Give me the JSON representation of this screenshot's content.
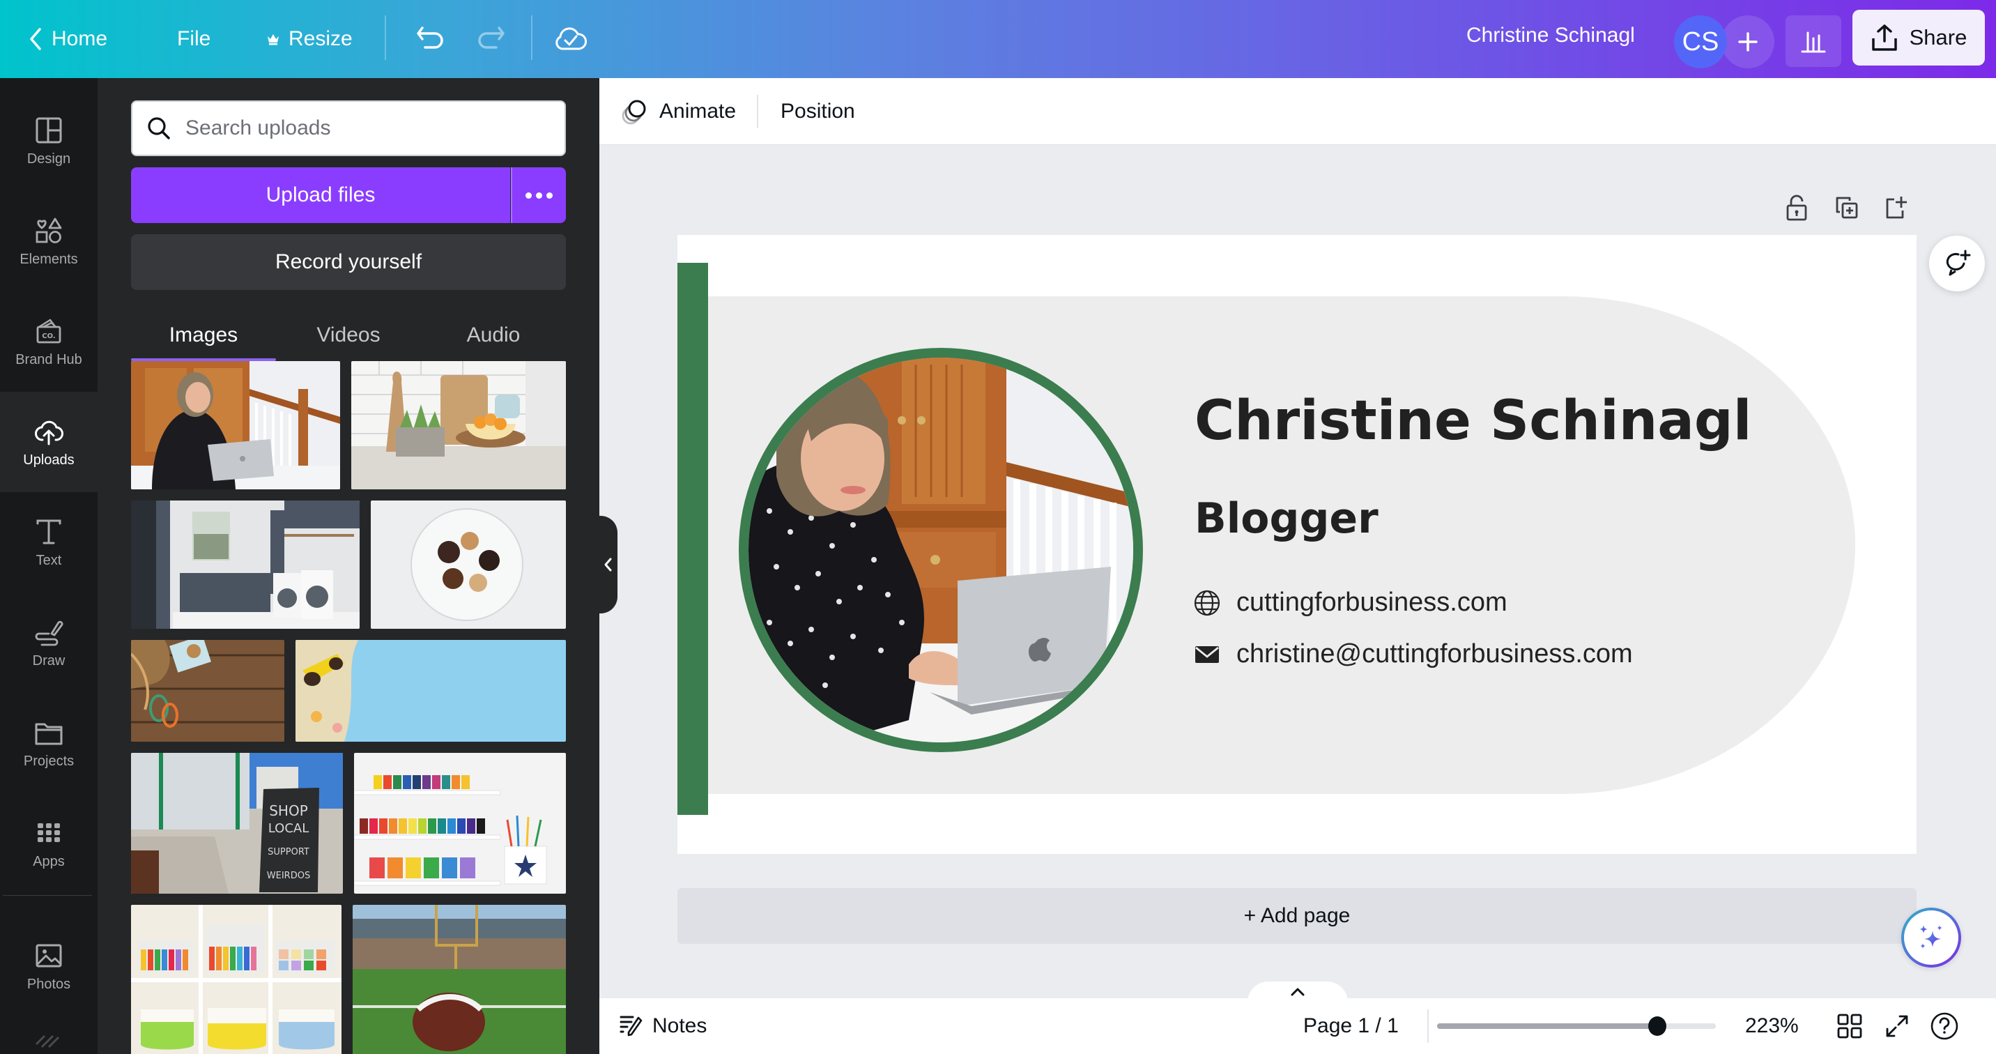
{
  "topbar": {
    "home_label": "Home",
    "file_label": "File",
    "resize_label": "Resize",
    "user_name": "Christine Schinagl",
    "avatar_initials": "CS",
    "share_label": "Share",
    "gradient_colors": [
      "#00c4cc",
      "#7d2ae8"
    ]
  },
  "rail": {
    "items": [
      {
        "label": "Design",
        "icon": "design-icon"
      },
      {
        "label": "Elements",
        "icon": "elements-icon"
      },
      {
        "label": "Brand Hub",
        "icon": "brand-hub-icon"
      },
      {
        "label": "Uploads",
        "icon": "upload-cloud-icon",
        "active": true
      },
      {
        "label": "Text",
        "icon": "text-icon"
      },
      {
        "label": "Draw",
        "icon": "draw-icon"
      },
      {
        "label": "Projects",
        "icon": "folder-icon"
      },
      {
        "label": "Apps",
        "icon": "apps-grid-icon"
      },
      {
        "label": "Photos",
        "icon": "photos-icon"
      }
    ]
  },
  "uploads": {
    "search_placeholder": "Search uploads",
    "search_value": "",
    "upload_label": "Upload files",
    "record_label": "Record yourself",
    "accent_color": "#8b3dff",
    "tabs": [
      {
        "label": "Images",
        "active": true
      },
      {
        "label": "Videos",
        "active": false
      },
      {
        "label": "Audio",
        "active": false
      }
    ],
    "images": [
      {
        "name": "woman-laptop-photo"
      },
      {
        "name": "kitchen-counter-photo"
      },
      {
        "name": "laundry-room-photo"
      },
      {
        "name": "cookies-plate-photo"
      },
      {
        "name": "hiking-boots-wood-photo"
      },
      {
        "name": "beach-sunglasses-photo"
      },
      {
        "name": "shop-local-sign-photo"
      },
      {
        "name": "paint-shelf-photo"
      },
      {
        "name": "craft-storage-photo"
      },
      {
        "name": "football-field-photo"
      }
    ]
  },
  "context_toolbar": {
    "animate_label": "Animate",
    "position_label": "Position"
  },
  "design": {
    "name": "Christine Schinagl",
    "title": "Blogger",
    "website": "cuttingforbusiness.com",
    "email": "christine@cuttingforbusiness.com",
    "accent_color": "#3b7d4f",
    "panel_color": "#ededed"
  },
  "canvas": {
    "add_page_label": "+ Add page"
  },
  "footer": {
    "notes_label": "Notes",
    "page_indicator": "Page 1 / 1",
    "zoom_label": "223%",
    "zoom_slider_fraction": 0.79
  }
}
